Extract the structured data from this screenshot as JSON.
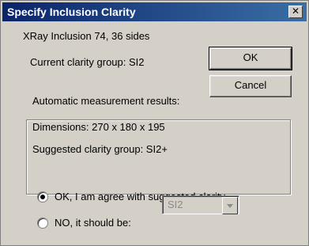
{
  "window": {
    "title": "Specify Inclusion Clarity",
    "close_glyph": "✕"
  },
  "info": {
    "inclusion": "XRay Inclusion 74, 36 sides",
    "current_group": "Current clarity group:  SI2"
  },
  "buttons": {
    "ok": "OK",
    "cancel": "Cancel"
  },
  "results": {
    "caption": "Automatic measurement results:",
    "dimensions": "Dimensions:  270 x 180 x 195",
    "suggested": "Suggested clarity group:  SI2+"
  },
  "choice": {
    "agree_label": "OK, I am agree with suggested clarity",
    "other_label": "NO, it should be:",
    "selected_option": "agree",
    "select_value": "SI2"
  }
}
